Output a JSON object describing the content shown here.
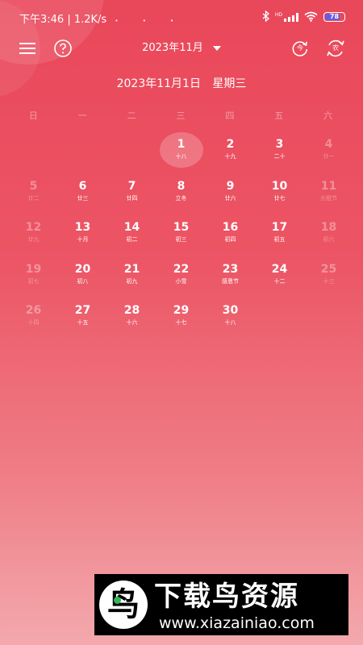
{
  "status_bar": {
    "time_speed": "下午3:46 | 1.2K/s",
    "dots": "• • •",
    "bluetooth_icon": "bluetooth-icon",
    "hd_label": "HD",
    "battery": "78",
    "battery_color": "#6a5ae0"
  },
  "header": {
    "menu_icon": "menu-icon",
    "help_icon": "help-icon",
    "month_label": "2023年11月",
    "today_icon_label": "今",
    "switch_icon_label": "农"
  },
  "selected_date": "2023年11月1日  星期三",
  "weekdays": [
    "日",
    "一",
    "二",
    "三",
    "四",
    "五",
    "六"
  ],
  "days": [
    {
      "num": "",
      "sub": "",
      "state": "empty"
    },
    {
      "num": "",
      "sub": "",
      "state": "empty"
    },
    {
      "num": "",
      "sub": "",
      "state": "empty"
    },
    {
      "num": "1",
      "sub": "十八",
      "state": "today"
    },
    {
      "num": "2",
      "sub": "十九",
      "state": "normal"
    },
    {
      "num": "3",
      "sub": "二十",
      "state": "normal"
    },
    {
      "num": "4",
      "sub": "廿一",
      "state": "other"
    },
    {
      "num": "5",
      "sub": "廿二",
      "state": "other"
    },
    {
      "num": "6",
      "sub": "廿三",
      "state": "normal"
    },
    {
      "num": "7",
      "sub": "廿四",
      "state": "normal"
    },
    {
      "num": "8",
      "sub": "立冬",
      "state": "normal"
    },
    {
      "num": "9",
      "sub": "廿六",
      "state": "normal"
    },
    {
      "num": "10",
      "sub": "廿七",
      "state": "normal"
    },
    {
      "num": "11",
      "sub": "光棍节",
      "state": "other"
    },
    {
      "num": "12",
      "sub": "廿九",
      "state": "other"
    },
    {
      "num": "13",
      "sub": "十月",
      "state": "normal"
    },
    {
      "num": "14",
      "sub": "初二",
      "state": "normal"
    },
    {
      "num": "15",
      "sub": "初三",
      "state": "normal"
    },
    {
      "num": "16",
      "sub": "初四",
      "state": "normal"
    },
    {
      "num": "17",
      "sub": "初五",
      "state": "normal"
    },
    {
      "num": "18",
      "sub": "初六",
      "state": "other"
    },
    {
      "num": "19",
      "sub": "初七",
      "state": "other"
    },
    {
      "num": "20",
      "sub": "初八",
      "state": "normal"
    },
    {
      "num": "21",
      "sub": "初九",
      "state": "normal"
    },
    {
      "num": "22",
      "sub": "小雪",
      "state": "normal"
    },
    {
      "num": "23",
      "sub": "感恩节",
      "state": "normal"
    },
    {
      "num": "24",
      "sub": "十二",
      "state": "normal"
    },
    {
      "num": "25",
      "sub": "十三",
      "state": "other"
    },
    {
      "num": "26",
      "sub": "十四",
      "state": "other"
    },
    {
      "num": "27",
      "sub": "十五",
      "state": "normal"
    },
    {
      "num": "28",
      "sub": "十六",
      "state": "normal"
    },
    {
      "num": "29",
      "sub": "十七",
      "state": "normal"
    },
    {
      "num": "30",
      "sub": "十八",
      "state": "normal"
    }
  ],
  "watermark": {
    "logo_glyph": "鸟",
    "name": "下载鸟资源",
    "url": "www.xiazainiao.com"
  }
}
